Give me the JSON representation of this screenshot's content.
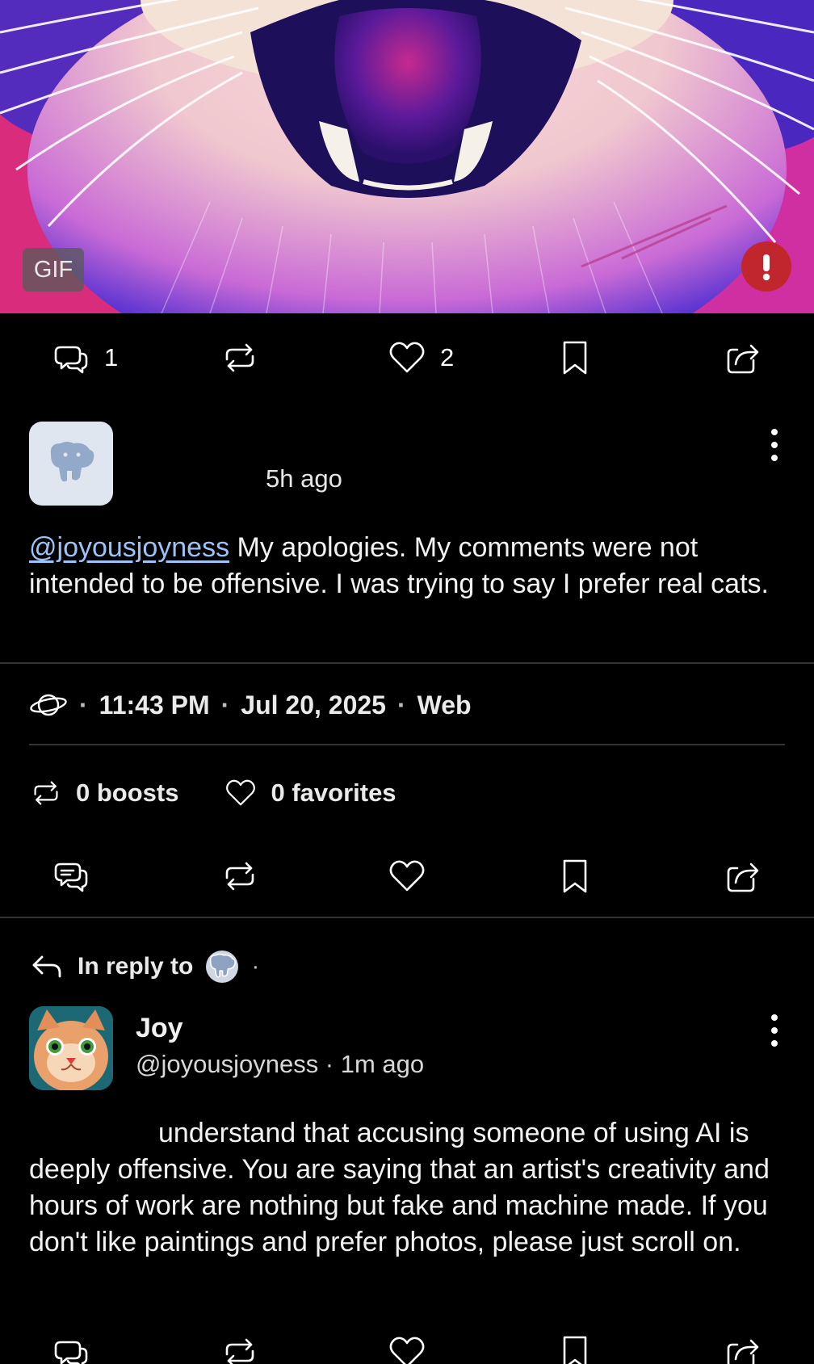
{
  "media": {
    "badge_label": "GIF",
    "alert_icon": "exclamation-icon"
  },
  "post1_actions": {
    "replies_count": "1",
    "boosts_count": "",
    "favorites_count": "2"
  },
  "post": {
    "time_ago": "5h ago",
    "mention": "@joyousjoyness",
    "body": " My apologies. My comments were not intended to be offensive. I was trying to say I prefer real cats.",
    "visibility_icon": "globe-icon",
    "time": "11:43 PM",
    "date": "Jul 20, 2025",
    "client": "Web",
    "separator": "·",
    "boosts_label": "0 boosts",
    "favorites_label": "0 favorites"
  },
  "reply": {
    "in_reply_to_label": "In reply to",
    "in_reply_to_suffix": "·",
    "author_name": "Joy",
    "handle_line": "@joyousjoyness · 1m ago",
    "body": "understand that accusing someone of using AI is deeply offensive. You are saying that an artist's creativity and hours of work are nothing but fake and machine made. If you don't like paintings and prefer photos, please just scroll on."
  },
  "colors": {
    "background": "#000000",
    "link": "#9cc3f7",
    "alert": "#c0262c",
    "divider": "#333333"
  }
}
